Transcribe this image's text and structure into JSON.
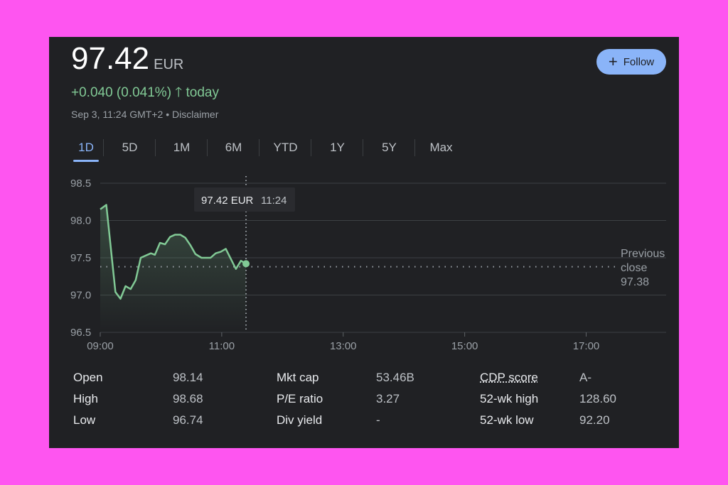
{
  "header": {
    "price": "97.42",
    "currency": "EUR",
    "change": "+0.040 (0.041%)",
    "change_icon": "arrow-up-icon",
    "change_suffix": "today",
    "timestamp": "Sep 3, 11:24 GMT+2",
    "disclaimer": "Disclaimer",
    "follow_label": "Follow"
  },
  "tabs": [
    "1D",
    "5D",
    "1M",
    "6M",
    "YTD",
    "1Y",
    "5Y",
    "Max"
  ],
  "active_tab": "1D",
  "tooltip": {
    "price": "97.42 EUR",
    "time": "11:24"
  },
  "previous_close": {
    "label1": "Previous",
    "label2": "close",
    "value": "97.38"
  },
  "colors": {
    "line": "#81c995",
    "accent": "#8ab4f8",
    "background": "#202124"
  },
  "chart_data": {
    "type": "line",
    "x": [
      "09:00",
      "09:06",
      "09:15",
      "09:20",
      "09:25",
      "09:30",
      "09:35",
      "09:40",
      "09:50",
      "09:54",
      "09:59",
      "10:04",
      "10:09",
      "10:14",
      "10:19",
      "10:24",
      "10:29",
      "10:34",
      "10:40",
      "10:49",
      "10:54",
      "10:59",
      "11:04",
      "11:14",
      "11:19",
      "11:24"
    ],
    "values": [
      98.15,
      98.21,
      97.04,
      96.95,
      97.12,
      97.08,
      97.2,
      97.5,
      97.56,
      97.54,
      97.7,
      97.68,
      97.78,
      97.81,
      97.81,
      97.77,
      97.67,
      97.55,
      97.5,
      97.5,
      97.56,
      97.58,
      97.62,
      97.35,
      97.46,
      97.42
    ],
    "ylim": [
      96.5,
      98.5
    ],
    "yticks": [
      "96.5",
      "97.0",
      "97.5",
      "98.0",
      "98.5"
    ],
    "xticks": [
      "09:00",
      "11:00",
      "13:00",
      "15:00",
      "17:00"
    ],
    "xlim": [
      "09:00",
      "18:19"
    ],
    "reference_line": 97.38,
    "grid": true
  },
  "stats": [
    {
      "label": "Open",
      "value": "98.14"
    },
    {
      "label": "High",
      "value": "98.68"
    },
    {
      "label": "Low",
      "value": "96.74"
    },
    {
      "label": "Mkt cap",
      "value": "53.46B"
    },
    {
      "label": "P/E ratio",
      "value": "3.27"
    },
    {
      "label": "Div yield",
      "value": "-"
    },
    {
      "label": "CDP score",
      "value": "A-"
    },
    {
      "label": "52-wk high",
      "value": "128.60"
    },
    {
      "label": "52-wk low",
      "value": "92.20"
    }
  ]
}
